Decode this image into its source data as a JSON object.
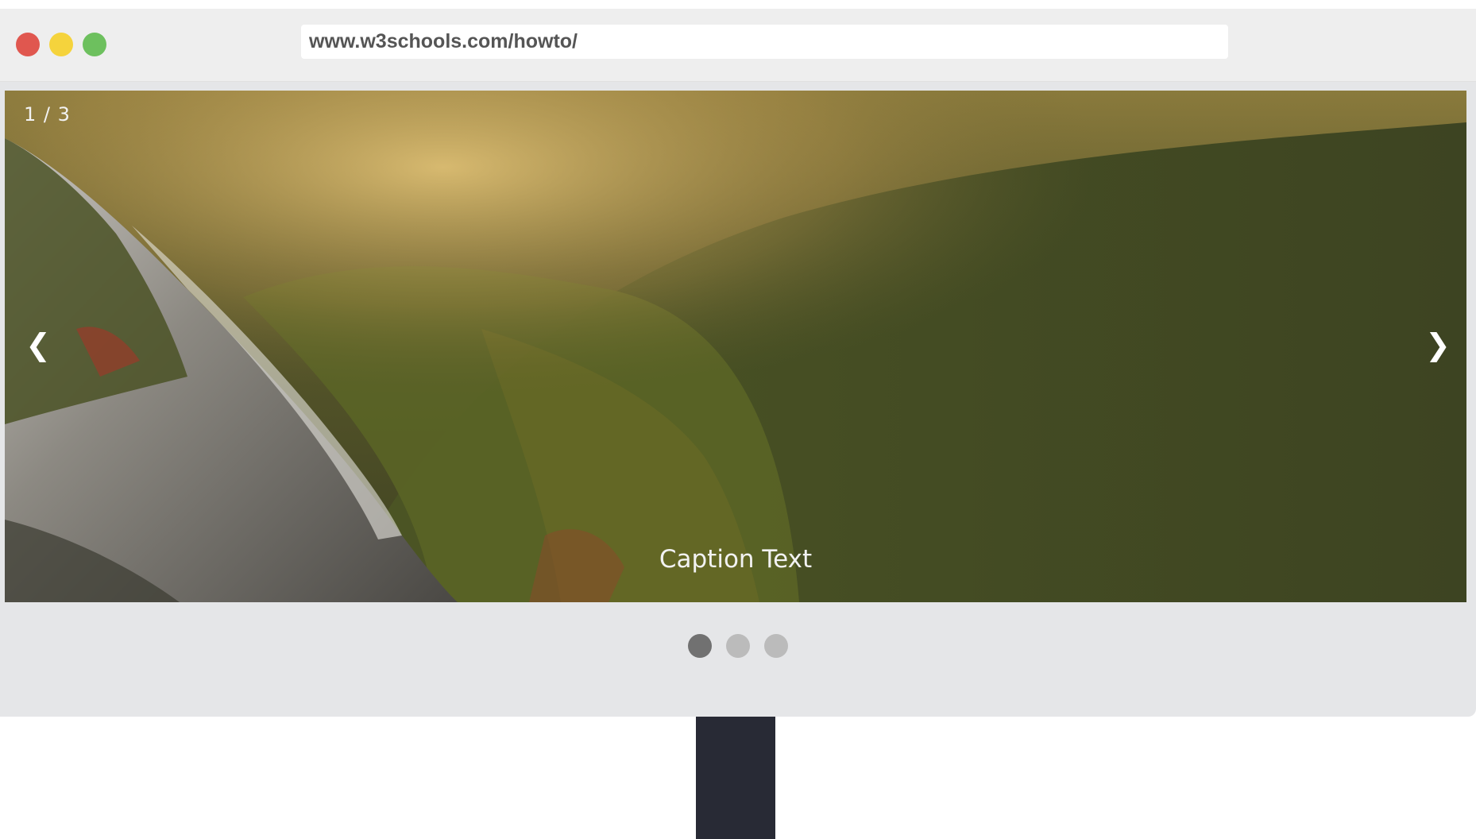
{
  "window": {
    "controls": [
      {
        "name": "close",
        "color": "#e0574f"
      },
      {
        "name": "minimize",
        "color": "#f5d33c"
      },
      {
        "name": "maximize",
        "color": "#6dc05e"
      }
    ],
    "url": "www.w3schools.com/howto/"
  },
  "slideshow": {
    "number_text": "1 / 3",
    "caption": "Caption Text",
    "prev_icon": "❮",
    "next_icon": "❯",
    "current_slide": 1,
    "total_slides": 3
  },
  "colors": {
    "monitor_frame": "#e5e6e8",
    "titlebar": "#eeeeee",
    "stand": "#282a35",
    "dot_active": "#717171",
    "dot_inactive": "#bbbbbb"
  }
}
